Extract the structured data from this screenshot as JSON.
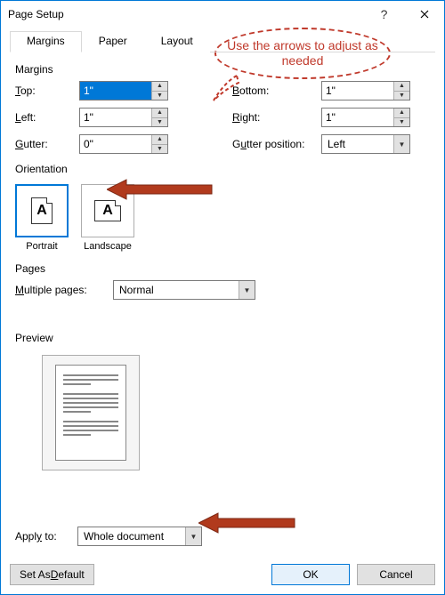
{
  "window": {
    "title": "Page Setup"
  },
  "tabs": {
    "margins": "Margins",
    "paper": "Paper",
    "layout": "Layout"
  },
  "margins": {
    "group": "Margins",
    "top_label": "Top:",
    "top_value": "1\"",
    "bottom_label": "Bottom:",
    "bottom_value": "1\"",
    "left_label": "Left:",
    "left_value": "1\"",
    "right_label": "Right:",
    "right_value": "1\"",
    "gutter_label": "Gutter:",
    "gutter_value": "0\"",
    "gutter_pos_label": "Gutter position:",
    "gutter_pos_value": "Left"
  },
  "orientation": {
    "group": "Orientation",
    "portrait": "Portrait",
    "landscape": "Landscape",
    "glyph": "A"
  },
  "pages": {
    "group": "Pages",
    "multiple_label": "Multiple pages:",
    "multiple_value": "Normal"
  },
  "preview": {
    "group": "Preview"
  },
  "apply": {
    "label": "Apply to:",
    "value": "Whole document"
  },
  "buttons": {
    "set_default": "Set As Default",
    "ok": "OK",
    "cancel": "Cancel"
  },
  "annotations": {
    "callout": "Use the arrows to adjust as needed",
    "color": "#b13a1d"
  }
}
